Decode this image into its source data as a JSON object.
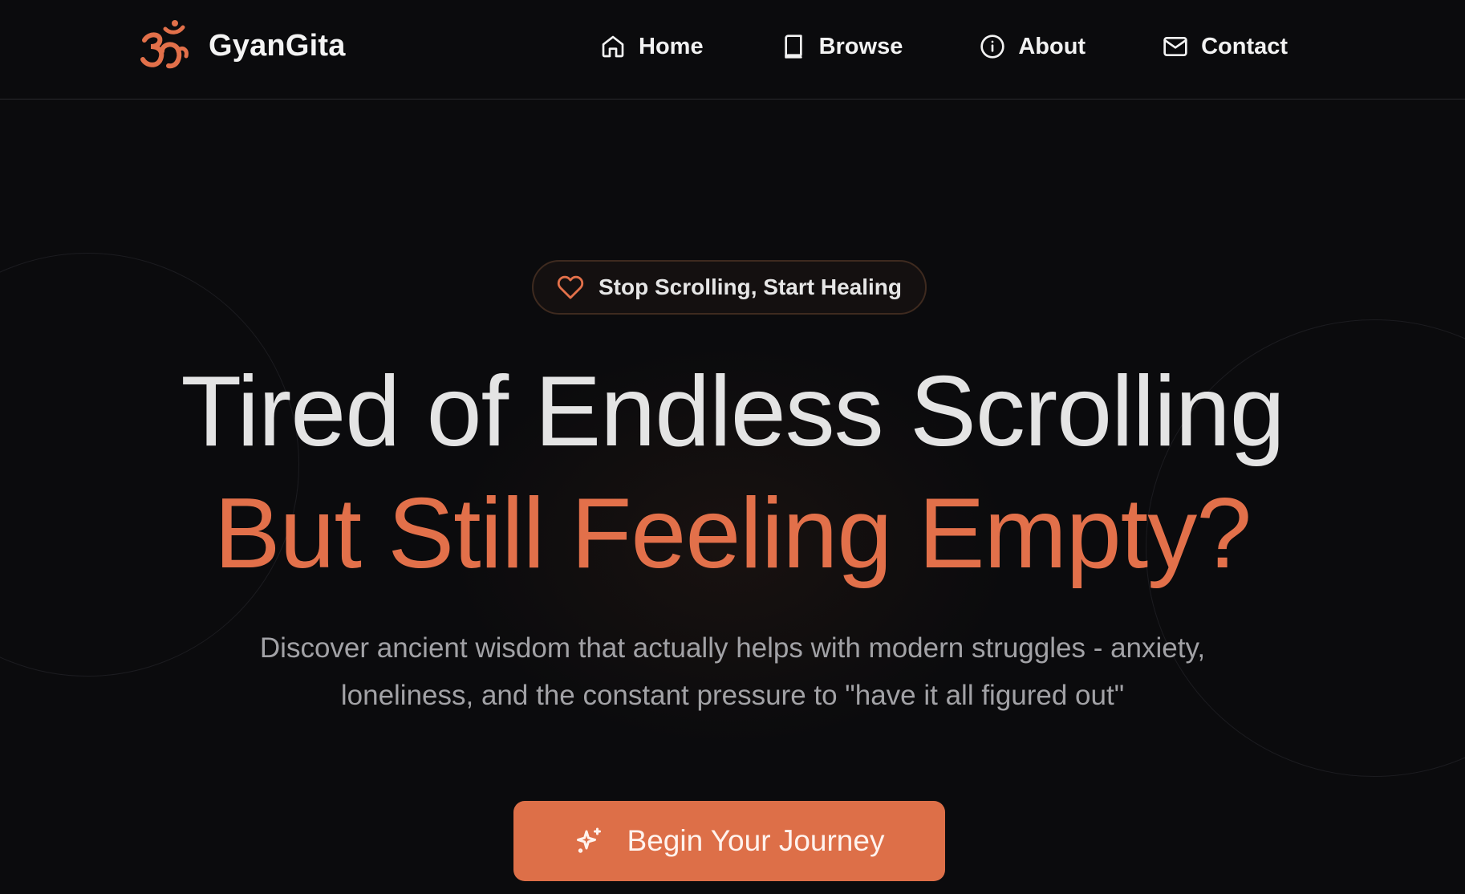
{
  "brand": {
    "name": "GyanGita",
    "logo_icon": "om-icon",
    "accent": "#e2704a"
  },
  "nav": {
    "items": [
      {
        "label": "Home",
        "icon": "home-icon"
      },
      {
        "label": "Browse",
        "icon": "book-icon"
      },
      {
        "label": "About",
        "icon": "info-icon"
      },
      {
        "label": "Contact",
        "icon": "mail-icon"
      }
    ]
  },
  "hero": {
    "badge": {
      "label": "Stop Scrolling, Start Healing",
      "icon": "heart-icon"
    },
    "headline_line1": "Tired of Endless Scrolling",
    "headline_line2": "But Still Feeling Empty?",
    "description": "Discover ancient wisdom that actually helps with modern struggles - anxiety, loneliness, and the constant pressure to \"have it all figured out\"",
    "cta": {
      "label": "Begin Your Journey",
      "icon": "sparkles-icon",
      "color": "#dd6f48"
    }
  }
}
